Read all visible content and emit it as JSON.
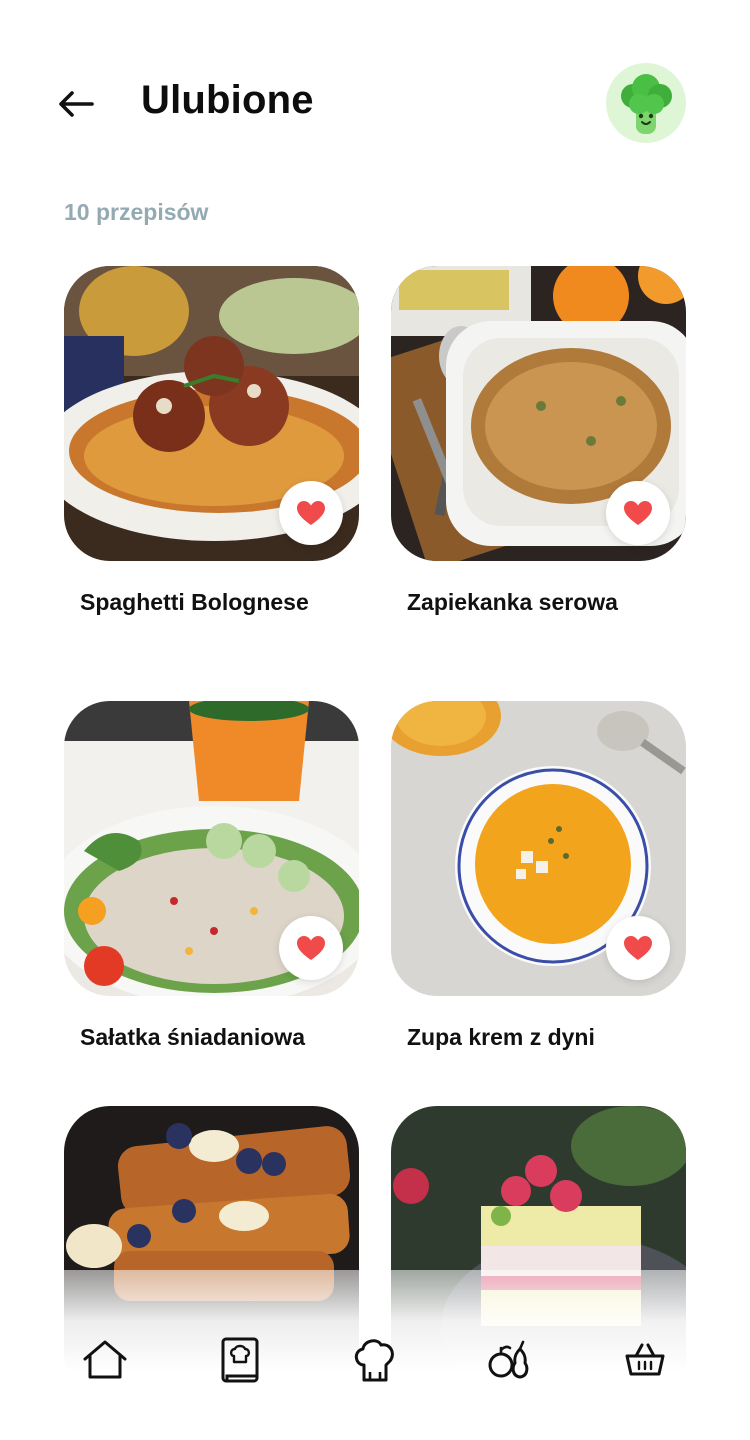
{
  "header": {
    "title": "Ulubione",
    "back_icon": "arrow-left-icon",
    "avatar_icon": "broccoli-mascot-icon"
  },
  "recipes_count": "10 przepisów",
  "recipes": [
    {
      "title": "Spaghetti Bolognese",
      "favorite": true
    },
    {
      "title": "Zapiekanka serowa",
      "favorite": true
    },
    {
      "title": "Sałatka śniadaniowa",
      "favorite": true
    },
    {
      "title": "Zupa krem z dyni",
      "favorite": true
    },
    {
      "title": "",
      "favorite": true
    },
    {
      "title": "",
      "favorite": true
    }
  ],
  "tabbar": {
    "items": [
      {
        "icon": "home-icon"
      },
      {
        "icon": "recipe-book-icon"
      },
      {
        "icon": "chef-hat-icon"
      },
      {
        "icon": "fruits-icon"
      },
      {
        "icon": "shopping-basket-icon"
      }
    ]
  },
  "colors": {
    "heart": "#f04a4a",
    "count_text": "#93aab3",
    "avatar_bg": "#dff6d6",
    "broccoli": "#4bbf4a"
  }
}
